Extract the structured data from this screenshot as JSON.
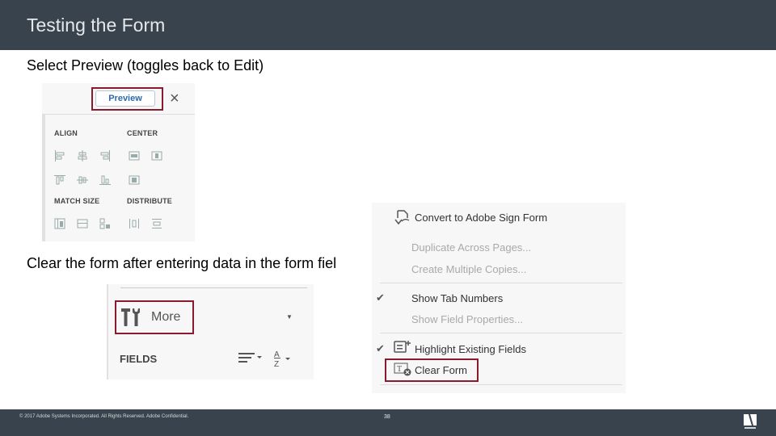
{
  "header": {
    "title": "Testing the Form"
  },
  "content": {
    "instruction_1": "Select Preview (toggles back to Edit)",
    "instruction_2": "Clear the form after entering data in the form fiel"
  },
  "panel_preview": {
    "preview_button": "Preview",
    "close_icon": "close-icon",
    "sections": {
      "align": "ALIGN",
      "center": "CENTER",
      "match_size": "MATCH SIZE",
      "distribute": "DISTRIBUTE"
    }
  },
  "panel_more": {
    "more_label": "More",
    "fields_label": "FIELDS"
  },
  "context_menu": {
    "items": [
      {
        "label": "Convert to Adobe Sign Form",
        "enabled": true,
        "checked": false
      },
      {
        "label": "Duplicate Across Pages...",
        "enabled": false,
        "checked": false
      },
      {
        "label": "Create Multiple Copies...",
        "enabled": false,
        "checked": false
      },
      {
        "label": "Show Tab Numbers",
        "enabled": true,
        "checked": true
      },
      {
        "label": "Show Field Properties...",
        "enabled": false,
        "checked": false
      },
      {
        "label": "Highlight Existing Fields",
        "enabled": true,
        "checked": true
      },
      {
        "label": "Clear Form",
        "enabled": true,
        "checked": false
      }
    ],
    "check_glyph": "✔"
  },
  "footer": {
    "copyright": "© 2017 Adobe Systems Incorporated.  All Rights Reserved.  Adobe Confidential.",
    "page_number": "38",
    "logo_text": "Adobe"
  }
}
